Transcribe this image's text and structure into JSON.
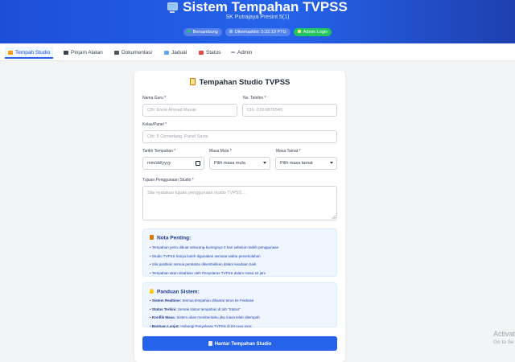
{
  "header": {
    "title": "Sistem Tempahan TVPSS",
    "subtitle": "SK Putrajaya Presint 5(1)",
    "badges": {
      "connection": "Bersambung",
      "updated": "Dikemaskini: 5:32:19 PTG",
      "admin": "Admin Login"
    }
  },
  "nav": {
    "tabs": [
      {
        "label": "Tempah Studio",
        "icon": "studio-icon"
      },
      {
        "label": "Pinjam Alatan",
        "icon": "camera-icon"
      },
      {
        "label": "Dokumentasi",
        "icon": "camcorder-icon"
      },
      {
        "label": "Jadual",
        "icon": "calendar-icon"
      },
      {
        "label": "Status",
        "icon": "clipboard-icon"
      },
      {
        "label": "Admin",
        "icon": "wrench-icon"
      }
    ]
  },
  "form": {
    "title": "Tempahan Studio TVPSS",
    "nama_guru": {
      "label": "Nama Guru *",
      "placeholder": "Cth: Encik Ahmad Razak"
    },
    "telefon": {
      "label": "No. Telefon *",
      "placeholder": "Cth: 019-9876543"
    },
    "kelas": {
      "label": "Kelas/Panel *",
      "placeholder": "Cth: 5 Cemerlang, Panel Sains"
    },
    "tarikh": {
      "label": "Tarikh Tempahan *",
      "value": "mm/dd/yyyy"
    },
    "masa_mula": {
      "label": "Masa Mula *",
      "value": "Pilih masa mula"
    },
    "masa_tamat": {
      "label": "Masa Tamat *",
      "value": "Pilih masa tamat"
    },
    "tujuan": {
      "label": "Tujuan Penggunaan Studio *",
      "placeholder": "Sila nyatakan tujuan penggunaan studio TVPSS..."
    },
    "submit_label": "Hantar Tempahan Studio"
  },
  "notes": {
    "title": "Nota Penting:",
    "items": [
      "Tempahan perlu dibuat sekurang-kurangnya 3 hari sebelum tarikh penggunaan",
      "Studio TVPSS hanya boleh digunakan semasa waktu persekolahan",
      "Sila pastikan semua peralatan dikembalikan dalam keadaan baik",
      "Tempahan akan disahkan oleh Penyelaras TVPSS dalam masa 24 jam"
    ]
  },
  "guide": {
    "title": "Panduan Sistem:",
    "items": [
      {
        "bold": "Sistem Realtime:",
        "text": "Semua tempahan dihantar terus ke Firebase"
      },
      {
        "bold": "Status Terkini:",
        "text": "Semak status tempahan di tab \"Status\""
      },
      {
        "bold": "Konflik Masa:",
        "text": "Sistem akan memberitahu jika masa telah ditempah"
      },
      {
        "bold": "Bantuan Lanjut:",
        "text": "Hubungi Penyelaras TVPSS di 03-xxxx-xxxx"
      }
    ]
  },
  "watermark": {
    "line1": "Activat",
    "line2": "Go to Se"
  },
  "colors": {
    "primary": "#2563eb",
    "header": "#1d4ed8",
    "success": "#22c55e",
    "note_bg": "#eff6ff"
  }
}
